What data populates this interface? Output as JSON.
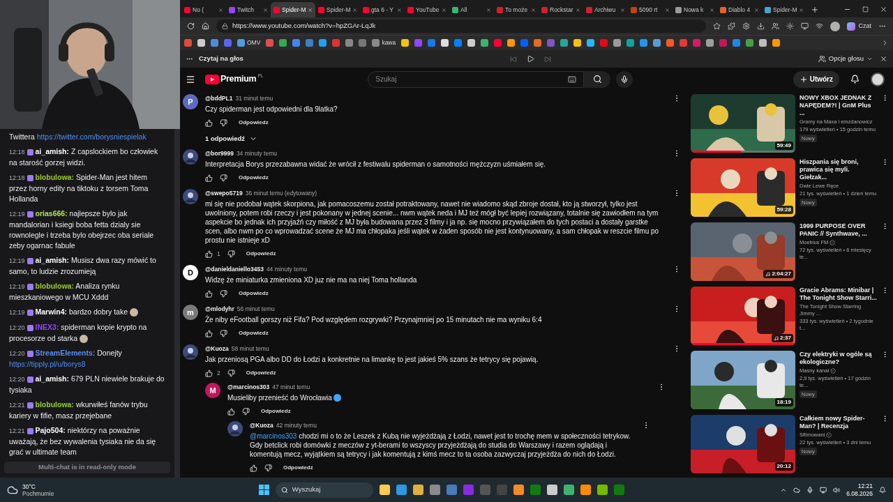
{
  "chat": {
    "messages": [
      {
        "text": "Twittera",
        "link": "https://twitter.com/borysniespielak"
      },
      {
        "time": "12:18",
        "user": "ai_amish:",
        "color": "#ffffff",
        "text": "Z capslockiem bo człowiek na starość gorzej widzi.",
        "emote": false
      },
      {
        "time": "12:18",
        "user": "blobulowa:",
        "color": "#9acd32",
        "text": "Spider-Man jest hitem przez horny edity na tiktoku z torsem Toma Hollanda",
        "emote": false
      },
      {
        "time": "12:19",
        "user": "orias666:",
        "color": "#b4e05a",
        "text": "najlepsze bylo jak mandalorian i ksiegi boba fetta dzialy sie rownolegle i trzeba bylo obejrzec oba seriale zeby ogarnac fabule",
        "emote": false
      },
      {
        "time": "12:19",
        "user": "ai_amish:",
        "color": "#ffffff",
        "text": "Musisz dwa razy mówić to samo, to ludzie zrozumieją",
        "emote": false
      },
      {
        "time": "12:19",
        "user": "blobulowa:",
        "color": "#9acd32",
        "text": "Analiza rynku mieszkaniowego w MCU Xddd",
        "emote": false
      },
      {
        "time": "12:19",
        "user": "Marwin4:",
        "color": "#ffffff",
        "text": "bardzo dobry take",
        "emote": true
      },
      {
        "time": "12:20",
        "user": "INEX3:",
        "color": "#9146ff",
        "text": "spiderman kopie krypto na procesorze od starka",
        "emote": true
      },
      {
        "time": "12:20",
        "user": "StreamElements:",
        "color": "#5b8def",
        "text": "Donejty",
        "link": "https://tipply.pl/u/borys8",
        "emote": false
      },
      {
        "time": "12:20",
        "user": "ai_amish:",
        "color": "#ffffff",
        "text": "679 PLN niewiele brakuje do tysiaka",
        "emote": false
      },
      {
        "time": "12:21",
        "user": "blobulowa:",
        "color": "#9acd32",
        "text": "wkurwiłeś fanów trybu kariery w fifie, masz przejebane",
        "emote": false
      },
      {
        "time": "12:21",
        "user": "Pajo504:",
        "color": "#ffffff",
        "text": "niektórzy na poważnie uważają, że bez wywalenia tysiaka nie da się grać w ultimate team",
        "emote": false
      }
    ],
    "footer": "Multi-chat is in read-only mode"
  },
  "tabs": [
    {
      "label": "No (",
      "color": "#ff0033",
      "selected": false
    },
    {
      "label": "Twitch",
      "color": "#9146ff",
      "selected": false
    },
    {
      "label": "Spider-M",
      "color": "#ff0033",
      "selected": true
    },
    {
      "label": "Spider-M",
      "color": "#ff0033",
      "selected": false
    },
    {
      "label": "gta 6 - Y",
      "color": "#ff0033",
      "selected": false
    },
    {
      "label": "YouTube",
      "color": "#ff0033",
      "selected": false
    },
    {
      "label": "All",
      "color": "#3cb371",
      "selected": false
    },
    {
      "label": "To może",
      "color": "#d0202e",
      "selected": false
    },
    {
      "label": "Rockstar",
      "color": "#d0202e",
      "selected": false
    },
    {
      "label": "Archiwu",
      "color": "#d0202e",
      "selected": false
    },
    {
      "label": "5090 rt",
      "color": "#c1440e",
      "selected": false
    },
    {
      "label": "Nowa k",
      "color": "#9a9a9a",
      "selected": false
    },
    {
      "label": "Diablo 4",
      "color": "#e0642a",
      "selected": false
    },
    {
      "label": "Spider-M",
      "color": "#4aa3c8",
      "selected": false
    }
  ],
  "address": {
    "url": "https://www.youtube.com/watch?v=hpZGAr-LqJk",
    "chat_label": "Czat"
  },
  "bookmarks": [
    {
      "color": "#e24a3b"
    },
    {
      "color": "#cccccc"
    },
    {
      "color": "#4a90d9"
    },
    {
      "color": "#5865f2"
    },
    {
      "color": "#4a9fe0",
      "label": "OMV"
    },
    {
      "color": "#e0504a"
    },
    {
      "color": "#34a853"
    },
    {
      "color": "#4285f4"
    },
    {
      "color": "#3b82c4"
    },
    {
      "color": "#1da1f2"
    },
    {
      "color": "#d33"
    },
    {
      "color": "#888888"
    },
    {
      "color": "#777777"
    },
    {
      "color": "#8a8a8a",
      "label": "kawa"
    },
    {
      "color": "#f4c20d"
    },
    {
      "color": "#9146ff"
    },
    {
      "color": "#1877f2"
    },
    {
      "color": "#dddddd"
    },
    {
      "color": "#0085ff"
    },
    {
      "color": "#cccccc"
    },
    {
      "color": "#3cb371"
    },
    {
      "color": "#ff0033"
    },
    {
      "color": "#ff9900"
    },
    {
      "color": "#0061ff"
    },
    {
      "color": "#e66a1f"
    },
    {
      "color": "#7e57c2"
    },
    {
      "color": "#26a69a"
    },
    {
      "color": "#f4c20d"
    },
    {
      "color": "#29b6f6"
    },
    {
      "color": "#e50914"
    },
    {
      "color": "#9a9a9a"
    },
    {
      "color": "#0ea5a4"
    },
    {
      "color": "#2196f3"
    },
    {
      "color": "#5b9bd5"
    },
    {
      "color": "#ff5722"
    },
    {
      "color": "#e53935"
    },
    {
      "color": "#d81b60"
    },
    {
      "color": "#9e9e9e"
    },
    {
      "color": "#c2185b"
    },
    {
      "color": "#1e88e5"
    },
    {
      "color": "#43a047"
    },
    {
      "color": "#bdbdbd"
    },
    {
      "color": "#ff9800"
    }
  ],
  "read_aloud": {
    "title": "Czytaj na głos",
    "options": "Opcje głosu"
  },
  "youtube": {
    "logo": "Premium",
    "region": "PL",
    "search_placeholder": "Szukaj",
    "create": "Utwórz"
  },
  "comments": [
    {
      "author": "@bddPL1",
      "time": "31 minut temu",
      "text": "Czy spiderman jest odpowiedni dla 9latka?",
      "letter": "P",
      "color": "#5c6bc0",
      "reply_label": "Odpowiedz",
      "replies_toggle": "1 odpowiedź"
    },
    {
      "author": "@bor9999",
      "time": "34 minuty temu",
      "text": "Interpretacja Borys przezabawna widać że wrócił z festiwalu spiderman o samotności mężczyzn uśmiałem się.",
      "reply_label": "Odpowiedz"
    },
    {
      "author": "@swepo5719",
      "time": "36 minut temu (edytowany)",
      "text": "mi się nie podobał wątek skorpiona, jak pomacoszemu został potraktowany, nawet nie wiadomo skąd zbroje dostał, kto ją stworzył, tylko jest uwolniony, potem robi rzeczy i jest pokonany w jednej scenie... nwm wątek neda i MJ też mógł być lepiej rozwiązany, totalnie się zawiodłem na tym aspekcie bo jednak ich przyjaźń czy miłość z MJ była budowana przez 3 filmy i ja np. się mocno przywiązałem do tych postaci a dostały garstke scen, albo nwm po co wprowadzać scene że MJ ma chłopaka jeśli wątek w żaden sposób nie jest kontynuowany, a sam chłopak w reszcie filmu po prostu nie istnieje xD",
      "likes": "1",
      "reply_label": "Odpowiedz"
    },
    {
      "author": "@danieldaniello3453",
      "time": "44 minuty temu",
      "text": "Widzę że miniaturka zmieniona XD juz nie ma na niej Toma hollanda",
      "letter": "D",
      "color": "#ffffff",
      "reply_label": "Odpowiedz"
    },
    {
      "author": "@mlodyhr",
      "time": "56 minut temu",
      "text": "Że niby eFootball gorszy niż Fifa? Pod względem rozgrywki? Przynajmniej po 15 minutach nie ma wyniku 6:4",
      "letter": "m",
      "color": "#7a7a7a",
      "reply_label": "Odpowiedz"
    },
    {
      "author": "@Kuoza",
      "time": "58 minut temu",
      "text": "Jak przeniosą PGA albo DD do Łodzi a konkretnie na limankę to jest jakieś 5% szans że tetrycy się pojawią.",
      "likes": "2",
      "reply_label": "Odpowiedz",
      "children": [
        {
          "author": "@marcinos303",
          "time": "47 minut temu",
          "text": "Musieliby przenieść do Wrocławia",
          "emoji": true,
          "letter": "M",
          "color": "#c2185b",
          "reply_label": "Odpowiedz",
          "children": [
            {
              "author": "@Kuoza",
              "time": "42 minuty temu",
              "mention": "@marcinos303",
              "text": "chodzi mi o to że Leszek z Kubą nie wyjeżdżają z Łodzi, nawet jest to trochę mem w społeczności tetrykow. Gdy betclick robi domówki z meczów z yt-berami to wszyscy przyjeżdżają do studia do Warszawy i razem oglądają i komentują mecz, wyjątkiem są tetrycy i jak komentują z kimś mecz to ta osoba zazwyczaj przyjeżdża do nich do Łodzi.",
              "reply_label": "Odpowiedz"
            }
          ]
        }
      ]
    }
  ],
  "videos": [
    {
      "title": "NOWY XBOX JEDNAK Z NAPĘDEM?! | GnM Plus ...",
      "channel": "Gramy na Maxa i emzdanowicz",
      "verified": false,
      "meta": "179 wyświetleń • 15 godzin temu",
      "badge": "Nowy",
      "duration": "59:49",
      "music": false,
      "level": 0.48
    },
    {
      "title": "Hiszpania się broni, prawica się myli. Giełzak...",
      "channel": "Dwie Lewe Ręce",
      "verified": false,
      "meta": "21 tys. wyświetleń • 1 dzień temu",
      "badge": "Nowy",
      "duration": "59:28",
      "music": false
    },
    {
      "title": "1999 PURPOSE OVER PANIC // Synthwave, ...",
      "channel": "Moebius FM",
      "verified": true,
      "meta": "72 tys. wyświetleń • 6 miesięcy te...",
      "duration": "2:04:27",
      "music": true
    },
    {
      "title": "Gracie Abrams: Minibar | The Tonight Show Starri...",
      "channel": "The Tonight Show Starring Jimmy ...",
      "verified": false,
      "meta": "333 tys. wyświetleń • 2 tygodnie t...",
      "duration": "2:37",
      "music": true,
      "level": 1
    },
    {
      "title": "Czy elektryki w ogóle są ekologiczne?",
      "channel": "Masny kanał",
      "verified": true,
      "meta": "2,9 tys. wyświetleń • 17 godzin te...",
      "badge": "Nowy",
      "duration": "18:19",
      "music": false
    },
    {
      "title": "Całkiem nowy Spider-Man? | Recenzja",
      "channel": "Sfilmowani",
      "verified": true,
      "meta": "22 tys. wyświetleń • 3 dni temu",
      "badge": "Nowy",
      "duration": "20:12",
      "music": false
    }
  ],
  "taskbar": {
    "temperature": "30°C",
    "weather": "Pochmurnie",
    "search": "Wyszukaj",
    "time": "12:21",
    "date": "6.08.2026"
  }
}
